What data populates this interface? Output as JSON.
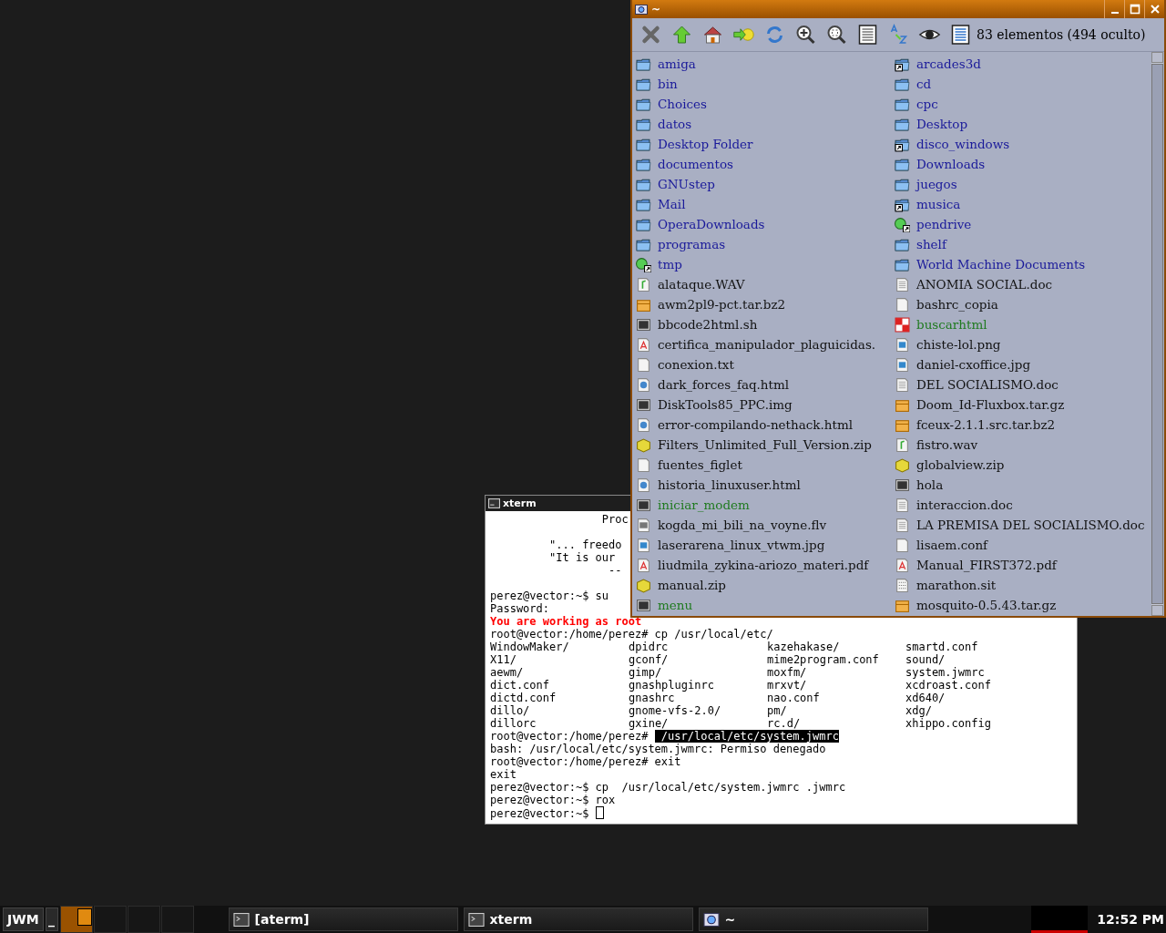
{
  "file_manager": {
    "title": "~",
    "status": "83 elementos (494 oculto)",
    "files": [
      {
        "name": "amiga",
        "kind": "folder"
      },
      {
        "name": "bin",
        "kind": "folder"
      },
      {
        "name": "Choices",
        "kind": "folder"
      },
      {
        "name": "datos",
        "kind": "folder"
      },
      {
        "name": "Desktop Folder",
        "kind": "folder"
      },
      {
        "name": "documentos",
        "kind": "folder"
      },
      {
        "name": "GNUstep",
        "kind": "folder"
      },
      {
        "name": "Mail",
        "kind": "folder"
      },
      {
        "name": "OperaDownloads",
        "kind": "folder"
      },
      {
        "name": "programas",
        "kind": "folder"
      },
      {
        "name": "tmp",
        "kind": "mount"
      },
      {
        "name": "alataque.WAV",
        "kind": "audio"
      },
      {
        "name": "awm2pl9-pct.tar.bz2",
        "kind": "archive"
      },
      {
        "name": "bbcode2html.sh",
        "kind": "script"
      },
      {
        "name": "certifica_manipulador_plaguicidas.",
        "kind": "pdf"
      },
      {
        "name": "conexion.txt",
        "kind": "text"
      },
      {
        "name": "dark_forces_faq.html",
        "kind": "html"
      },
      {
        "name": "DiskTools85_PPC.img",
        "kind": "script"
      },
      {
        "name": "error-compilando-nethack.html",
        "kind": "html"
      },
      {
        "name": "Filters_Unlimited_Full_Version.zip",
        "kind": "zip"
      },
      {
        "name": "fuentes_figlet",
        "kind": "text"
      },
      {
        "name": "historia_linuxuser.html",
        "kind": "html"
      },
      {
        "name": "iniciar_modem",
        "kind": "program"
      },
      {
        "name": "kogda_mi_bili_na_voyne.flv",
        "kind": "video"
      },
      {
        "name": "laserarena_linux_vtwm.jpg",
        "kind": "image"
      },
      {
        "name": "liudmila_zykina-ariozo_materi.pdf",
        "kind": "pdf"
      },
      {
        "name": "manual.zip",
        "kind": "zip"
      },
      {
        "name": "menu",
        "kind": "program"
      },
      {
        "name": "arcades3d",
        "kind": "symlink"
      },
      {
        "name": "cd",
        "kind": "folder"
      },
      {
        "name": "cpc",
        "kind": "folder"
      },
      {
        "name": "Desktop",
        "kind": "folder"
      },
      {
        "name": "disco_windows",
        "kind": "symlink"
      },
      {
        "name": "Downloads",
        "kind": "folder"
      },
      {
        "name": "juegos",
        "kind": "folder"
      },
      {
        "name": "musica",
        "kind": "symlink"
      },
      {
        "name": "pendrive",
        "kind": "mount"
      },
      {
        "name": "shelf",
        "kind": "folder"
      },
      {
        "name": "World Machine Documents",
        "kind": "folder"
      },
      {
        "name": "ANOMIA SOCIAL.doc",
        "kind": "doc"
      },
      {
        "name": "bashrc_copia",
        "kind": "text"
      },
      {
        "name": "buscarhtml",
        "kind": "app"
      },
      {
        "name": "chiste-lol.png",
        "kind": "image"
      },
      {
        "name": "daniel-cxoffice.jpg",
        "kind": "image"
      },
      {
        "name": "DEL SOCIALISMO.doc",
        "kind": "doc"
      },
      {
        "name": "Doom_Id-Fluxbox.tar.gz",
        "kind": "archive"
      },
      {
        "name": "fceux-2.1.1.src.tar.bz2",
        "kind": "archive"
      },
      {
        "name": "fistro.wav",
        "kind": "audio"
      },
      {
        "name": "globalview.zip",
        "kind": "zip"
      },
      {
        "name": "hola",
        "kind": "script"
      },
      {
        "name": "interaccion.doc",
        "kind": "doc"
      },
      {
        "name": "LA PREMISA DEL SOCIALISMO.doc",
        "kind": "doc"
      },
      {
        "name": "lisaem.conf",
        "kind": "text"
      },
      {
        "name": "Manual_FIRST372.pdf",
        "kind": "pdf"
      },
      {
        "name": "marathon.sit",
        "kind": "stuffit"
      },
      {
        "name": "mosquito-0.5.43.tar.gz",
        "kind": "archive"
      }
    ]
  },
  "terminal": {
    "title": "xterm",
    "lines": [
      {
        "kind": "text",
        "text": "                 Proc"
      },
      {
        "kind": "blank"
      },
      {
        "kind": "text",
        "text": "         \"... freedo"
      },
      {
        "kind": "text",
        "text": "         \"It is our"
      },
      {
        "kind": "text",
        "text": "                  --"
      },
      {
        "kind": "blank"
      },
      {
        "kind": "text",
        "text": "perez@vector:~$ su"
      },
      {
        "kind": "text",
        "text": "Password:"
      },
      {
        "kind": "warning",
        "text": "You are working as root"
      },
      {
        "kind": "text",
        "text": "root@vector:/home/perez# cp /usr/local/etc/"
      },
      {
        "kind": "listing",
        "cells": [
          "WindowMaker/",
          "dpidrc",
          "kazehakase/",
          "smartd.conf"
        ]
      },
      {
        "kind": "listing",
        "cells": [
          "X11/",
          "gconf/",
          "mime2program.conf",
          "sound/"
        ]
      },
      {
        "kind": "listing",
        "cells": [
          "aewm/",
          "gimp/",
          "moxfm/",
          "system.jwmrc"
        ]
      },
      {
        "kind": "listing",
        "cells": [
          "dict.conf",
          "gnashpluginrc",
          "mrxvt/",
          "xcdroast.conf"
        ]
      },
      {
        "kind": "listing",
        "cells": [
          "dictd.conf",
          "gnashrc",
          "nao.conf",
          "xd640/"
        ]
      },
      {
        "kind": "listing",
        "cells": [
          "dillo/",
          "gnome-vfs-2.0/",
          "pm/",
          "xdg/"
        ]
      },
      {
        "kind": "listing",
        "cells": [
          "dillorc",
          "gxine/",
          "rc.d/",
          "xhippo.config"
        ]
      },
      {
        "kind": "selection",
        "text": "root@vector:/home/perez# ",
        "selected_text": " /usr/local/etc/system.jwmrc"
      },
      {
        "kind": "text",
        "text": "bash: /usr/local/etc/system.jwmrc: Permiso denegado"
      },
      {
        "kind": "text",
        "text": "root@vector:/home/perez# exit"
      },
      {
        "kind": "text",
        "text": "exit"
      },
      {
        "kind": "text",
        "text": "perez@vector:~$ cp  /usr/local/etc/system.jwmrc .jwmrc"
      },
      {
        "kind": "text",
        "text": "perez@vector:~$ rox"
      },
      {
        "kind": "cursor",
        "text": "perez@vector:~$ "
      }
    ]
  },
  "taskbar": {
    "menu_label": "JWM",
    "show_desktop_label": "_",
    "desktops": [
      {
        "selected": true
      },
      {
        "selected": false
      },
      {
        "selected": false
      },
      {
        "selected": false
      }
    ],
    "tasks": [
      {
        "label": "[aterm]",
        "kind": "terminal"
      },
      {
        "label": "xterm",
        "kind": "terminal"
      },
      {
        "label": "~",
        "kind": "file_manager"
      }
    ],
    "clock": "12:52 PM"
  }
}
